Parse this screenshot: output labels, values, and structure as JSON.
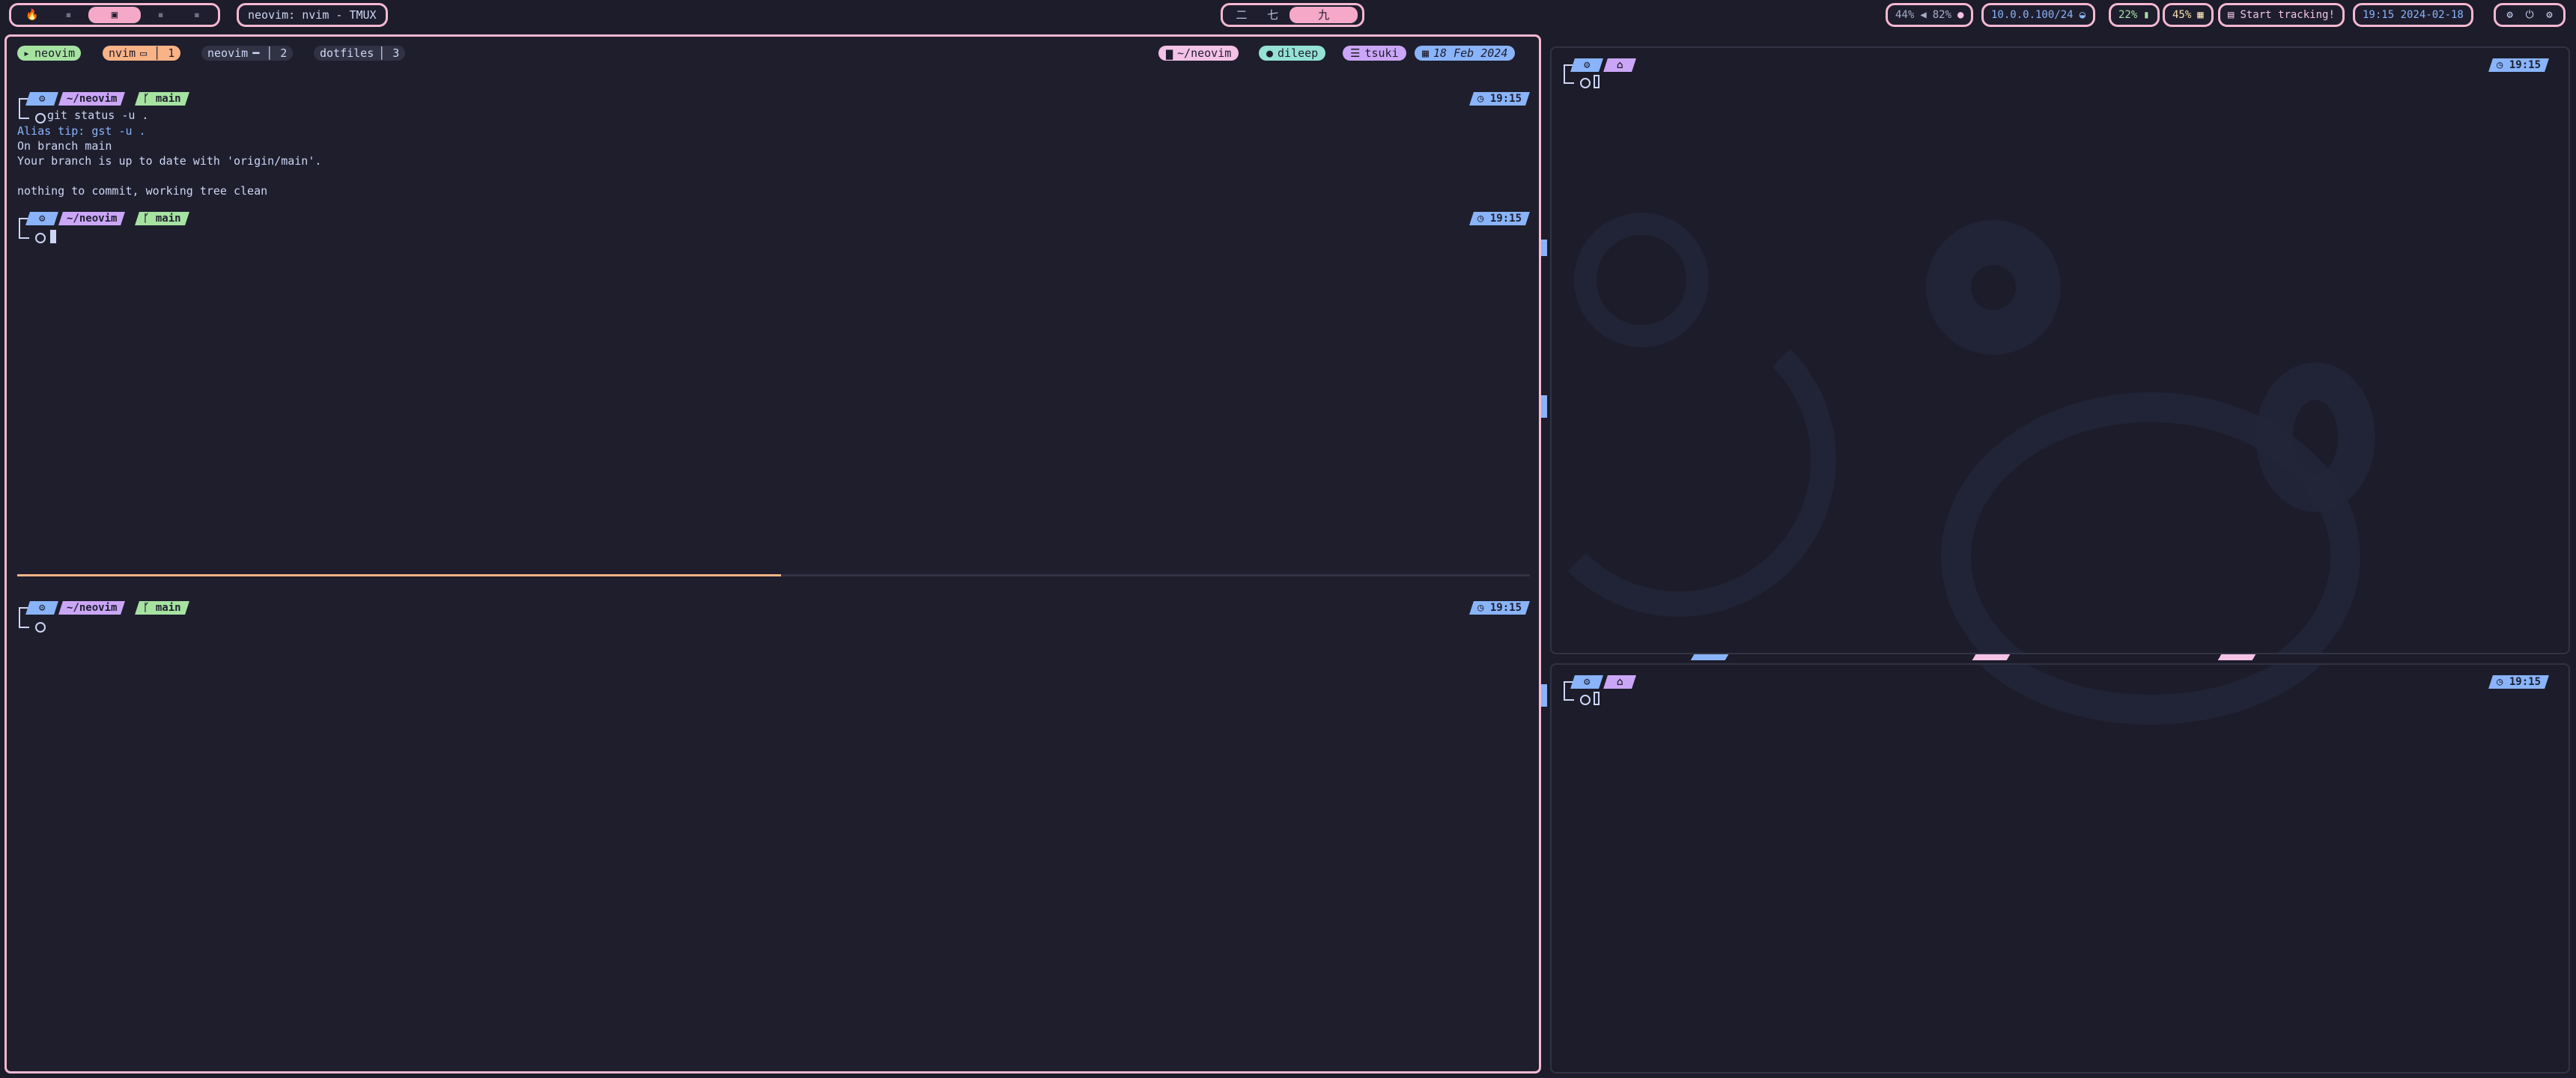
{
  "bar": {
    "workspaces": [
      "🔥",
      "▪",
      "▣",
      "▪",
      "▪"
    ],
    "window_title": "neovim: nvim - TMUX",
    "kanji": [
      "二",
      "七",
      "九"
    ],
    "audio": {
      "volume": "44%",
      "mic": "82%"
    },
    "network": "10.0.0.100/24",
    "battery": "22%",
    "memory": "45%",
    "tracking": "Start tracking!",
    "datetime": "19:15 2024-02-18",
    "sys_icons": [
      "⚙",
      "⏻",
      "⚙"
    ]
  },
  "tmux": {
    "tabs": [
      {
        "icon": "▸",
        "label": "neovim",
        "num": ""
      },
      {
        "icon": "",
        "label": "nvim",
        "num": "1"
      },
      {
        "icon": "",
        "label": "neovim",
        "num": "2"
      },
      {
        "icon": "",
        "label": "dotfiles",
        "num": "3"
      }
    ],
    "right": {
      "dir": "~/neovim",
      "user": "dileep",
      "host": "tsuki",
      "date": "18 Feb 2024"
    }
  },
  "pane1": {
    "prompt1": {
      "gear": "⚙",
      "path": "~/neovim",
      "branch": "main",
      "time": "19:15"
    },
    "command": "git status -u .",
    "output": [
      "Alias tip: gst -u .",
      "On branch main",
      "Your branch is up to date with 'origin/main'.",
      "",
      "nothing to commit, working tree clean"
    ],
    "prompt2": {
      "gear": "⚙",
      "path": "~/neovim",
      "branch": "main",
      "time": "19:15"
    }
  },
  "pane2": {
    "prompt": {
      "gear": "⚙",
      "path": "~/neovim",
      "branch": "main",
      "time": "19:15"
    }
  },
  "right_top": {
    "gear": "⚙",
    "home": "⌂",
    "time": "19:15"
  },
  "right_bottom": {
    "gear": "⚙",
    "home": "⌂",
    "time": "19:15"
  }
}
